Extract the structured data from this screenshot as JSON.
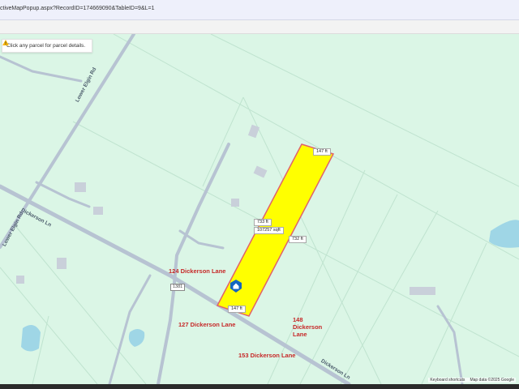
{
  "browser": {
    "url_fragment": "ctiveMapPopup.aspx?RecordID=174669090&TableID=9&L=1"
  },
  "map": {
    "notice": "Click any parcel for parcel details.",
    "dimensions": {
      "top": "147 ft",
      "bottom": "147 ft",
      "left_side": "733 ft",
      "right_side": "732 ft",
      "area": "107257 sqft"
    },
    "addresses": {
      "a124": "124 Dickerson Lane",
      "a127": "127 Dickerson Lane",
      "a148_line1": "148",
      "a148_line2": "Dickerson",
      "a148_line3": "Lane",
      "a153": "153 Dickerson Lane"
    },
    "streets": {
      "dickerson_ln_1": "Dickerson Ln",
      "dickerson_ln_2": "Dickerson Ln",
      "lower_elgin_rd_1": "Lower Elgin Rd",
      "lower_elgin_rd_2": "Lower Elgin Rd"
    },
    "route_shield": "1381",
    "attribution": {
      "shortcuts": "Keyboard shortcuts",
      "copyright": "Map data ©2025 Google"
    },
    "colors": {
      "parcel_fill": "#ffff00",
      "parcel_outline": "#e0626a",
      "address_text": "#c62828",
      "map_background": "#dbf6e6",
      "water": "#9fd6e6"
    }
  }
}
